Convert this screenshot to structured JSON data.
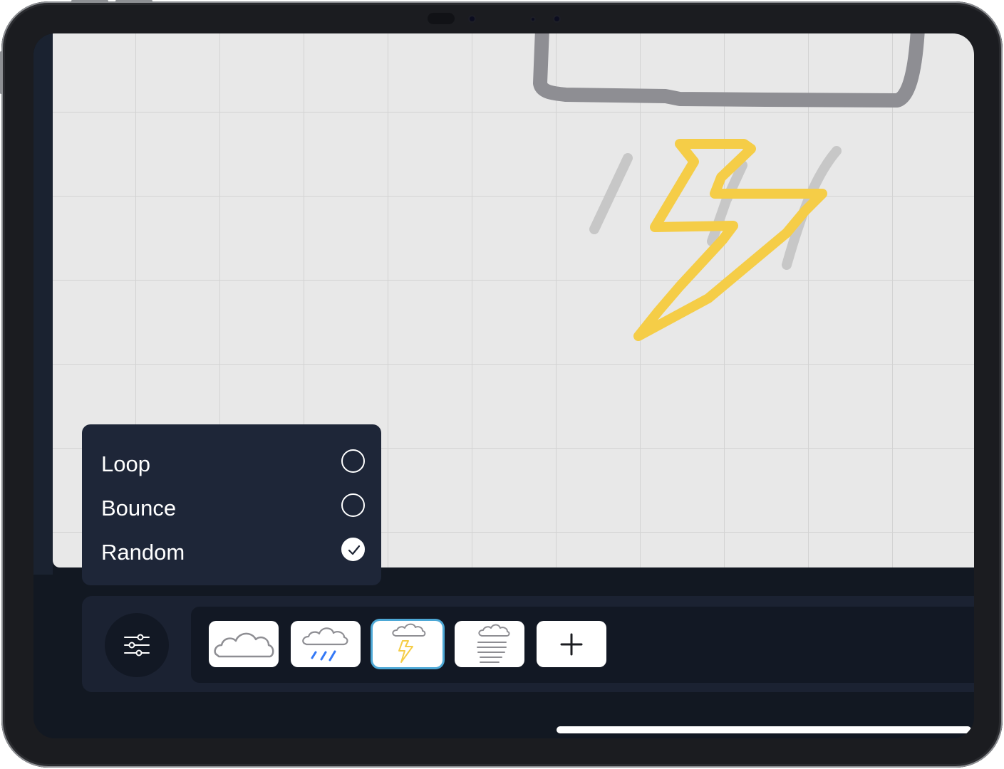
{
  "playback_modes": {
    "items": [
      {
        "label": "Loop",
        "selected": false
      },
      {
        "label": "Bounce",
        "selected": false
      },
      {
        "label": "Random",
        "selected": true
      }
    ]
  },
  "toolbar": {
    "settings_icon": "sliders-icon",
    "frames": [
      {
        "icon": "cloud-icon",
        "selected": false
      },
      {
        "icon": "cloud-rain-icon",
        "selected": false
      },
      {
        "icon": "cloud-lightning-icon",
        "selected": true
      },
      {
        "icon": "cloud-fog-icon",
        "selected": false
      }
    ],
    "add_icon": "plus-icon"
  },
  "colors": {
    "canvas": "#e8e8e8",
    "grid": "#d3d3d3",
    "cloud_stroke": "#8e8e93",
    "rain_stroke": "#c7c7c7",
    "lightning": "#f5cd47",
    "panel": "#1e2638",
    "selection": "#4da8d6"
  }
}
